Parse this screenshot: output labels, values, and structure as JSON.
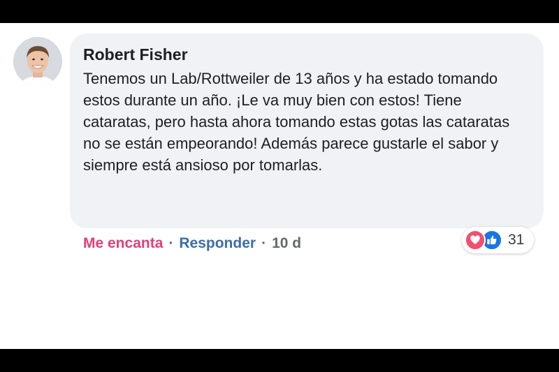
{
  "comment": {
    "author": "Robert Fisher",
    "text": "Tenemos un Lab/Rottweiler de 13 años y ha estado tomando estos durante un año. ¡Le va muy bien con estos! Tiene cataratas, pero hasta ahora tomando estas gotas las cataratas no se están empeorando! Además parece gustarle el sabor y siempre está ansioso por tomarlas.",
    "actions": {
      "love_label": "Me encanta",
      "separator": "·",
      "reply_label": "Responder",
      "time": "10 d"
    },
    "reactions": {
      "icons": [
        "heart-icon",
        "thumbs-up-icon"
      ],
      "count": "31"
    }
  },
  "colors": {
    "bubble_bg": "#f0f2f5",
    "love_text": "#e0407a",
    "reply_text": "#3b6ea8",
    "meta_text": "#65676b",
    "love_reaction": "#f0506e",
    "like_reaction": "#1b74e4"
  }
}
